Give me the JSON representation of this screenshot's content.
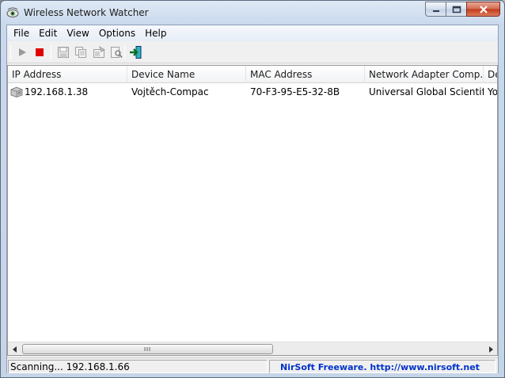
{
  "window": {
    "title": "Wireless Network Watcher"
  },
  "menu": [
    "File",
    "Edit",
    "View",
    "Options",
    "Help"
  ],
  "toolbar": {
    "buttons": [
      "play-icon",
      "stop-icon",
      "save-icon",
      "copy-icon",
      "properties-icon",
      "find-icon",
      "exit-icon"
    ]
  },
  "columns": [
    "IP Address",
    "Device Name",
    "MAC Address",
    "Network Adapter Comp...",
    "Dev"
  ],
  "rows": [
    {
      "ip": "192.168.1.38",
      "device_name": "Vojtěch-Compac",
      "mac": "70-F3-95-E5-32-8B",
      "adapter": "Universal Global Scientif...",
      "dev": "You"
    }
  ],
  "status": {
    "scanning": "Scanning... 192.168.1.66",
    "credit": "NirSoft Freeware.  http://www.nirsoft.net"
  },
  "colors": {
    "credit_text": "#0033cc",
    "stop_button": "#e00000",
    "close_button": "#c1381a"
  }
}
